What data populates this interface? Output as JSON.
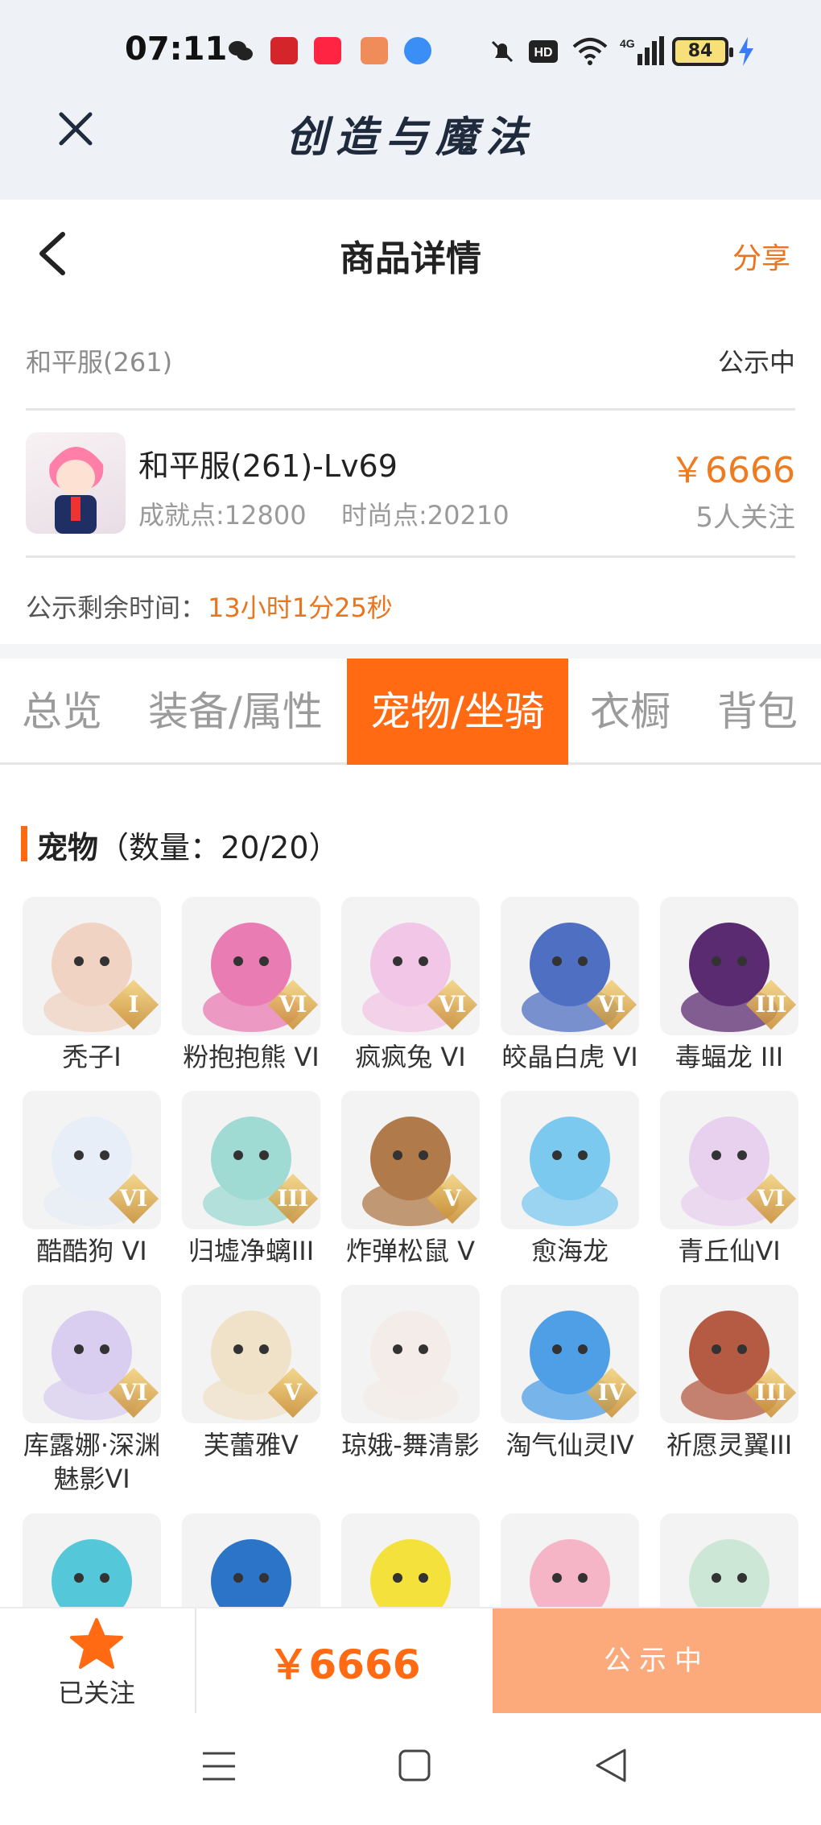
{
  "status_bar": {
    "time": "07:11",
    "battery": "84",
    "network": "4G"
  },
  "app_bar": {
    "title": "创造与魔法"
  },
  "header": {
    "title": "商品详情",
    "share": "分享"
  },
  "listing": {
    "server": "和平服(261)",
    "status": "公示中",
    "name": "和平服(261)-Lv69",
    "achievement": "成就点:12800",
    "fashion": "时尚点:20210",
    "price": "￥6666",
    "followers": "5人关注",
    "timer_label": "公示剩余时间：",
    "timer_value": "13小时1分25秒"
  },
  "tabs": [
    {
      "label": "总览"
    },
    {
      "label": "装备/属性"
    },
    {
      "label": "宠物/坐骑"
    },
    {
      "label": "衣橱"
    },
    {
      "label": "背包"
    }
  ],
  "pets_section": {
    "title": "宠物",
    "count": "（数量：20/20）"
  },
  "pets": [
    {
      "name": "秃子I",
      "rank": "I",
      "color": "#f0d3c2"
    },
    {
      "name": "粉抱抱熊 VI",
      "rank": "VI",
      "color": "#e97cb3"
    },
    {
      "name": "疯疯兔 VI",
      "rank": "VI",
      "color": "#f2c6e6"
    },
    {
      "name": "皎晶白虎 VI",
      "rank": "VI",
      "color": "#4f6fc2"
    },
    {
      "name": "毒蝠龙 III",
      "rank": "III",
      "color": "#5b2b72"
    },
    {
      "name": "酷酷狗 VI",
      "rank": "VI",
      "color": "#e7eef7"
    },
    {
      "name": "归墟净螭III",
      "rank": "III",
      "color": "#9fdad3"
    },
    {
      "name": "炸弹松鼠 V",
      "rank": "V",
      "color": "#b07a4a"
    },
    {
      "name": "愈海龙",
      "rank": "",
      "color": "#7cc9ef"
    },
    {
      "name": "青丘仙VI",
      "rank": "VI",
      "color": "#e8d0ef"
    },
    {
      "name": "库露娜·深渊魅影VI",
      "rank": "VI",
      "color": "#d9cdf0"
    },
    {
      "name": "芙蕾雅V",
      "rank": "V",
      "color": "#f0e2c8"
    },
    {
      "name": "琼娥-舞清影",
      "rank": "",
      "color": "#f4ece8"
    },
    {
      "name": "淘气仙灵IV",
      "rank": "IV",
      "color": "#4e9fe5"
    },
    {
      "name": "祈愿灵翼III",
      "rank": "III",
      "color": "#b55b43"
    },
    {
      "name": "",
      "rank": "",
      "color": "#54c7d9"
    },
    {
      "name": "",
      "rank": "",
      "color": "#2c74c8"
    },
    {
      "name": "",
      "rank": "",
      "color": "#f4e13b"
    },
    {
      "name": "",
      "rank": "",
      "color": "#f6b4c7"
    },
    {
      "name": "",
      "rank": "",
      "color": "#cde7d6"
    }
  ],
  "bottom_bar": {
    "follow_label": "已关注",
    "price": "￥6666",
    "action": "公示中"
  }
}
